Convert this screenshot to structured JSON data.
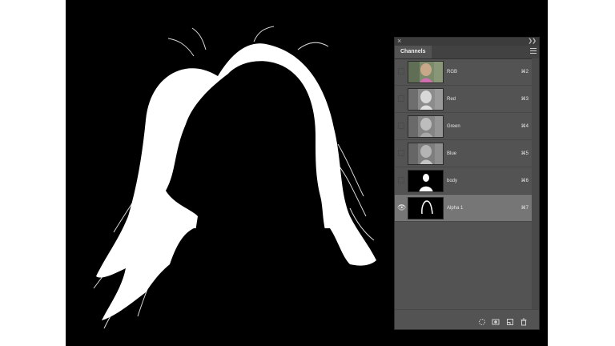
{
  "canvas": {
    "background": "#000000",
    "mask_color": "#ffffff"
  },
  "panel": {
    "title": "Channels",
    "close_icon": "close-icon",
    "collapse_icon": "collapse-icon",
    "menu_icon": "panel-menu-icon",
    "channels": [
      {
        "name": "RGB",
        "shortcut": "⌘2",
        "visible": false,
        "active": false,
        "thumb": "color"
      },
      {
        "name": "Red",
        "shortcut": "⌘3",
        "visible": false,
        "active": false,
        "thumb": "gray"
      },
      {
        "name": "Green",
        "shortcut": "⌘4",
        "visible": false,
        "active": false,
        "thumb": "gray"
      },
      {
        "name": "Blue",
        "shortcut": "⌘5",
        "visible": false,
        "active": false,
        "thumb": "gray"
      },
      {
        "name": "body",
        "shortcut": "⌘6",
        "visible": false,
        "active": false,
        "thumb": "body-mask"
      },
      {
        "name": "Alpha 1",
        "shortcut": "⌘7",
        "visible": true,
        "active": true,
        "thumb": "alpha-mask"
      }
    ],
    "footer_icons": [
      "load-selection-icon",
      "save-selection-icon",
      "new-channel-icon",
      "trash-icon"
    ]
  }
}
